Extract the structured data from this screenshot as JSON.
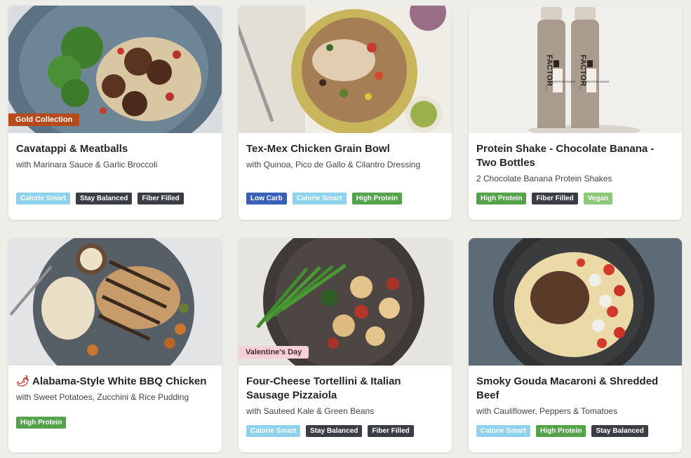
{
  "meals": [
    {
      "title": "Cavatappi & Meatballs",
      "subtitle": "with Marinara Sauce & Garlic Broccoli",
      "ribbon": "Gold Collection",
      "tags": [
        "Calorie Smart",
        "Stay Balanced",
        "Fiber Filled"
      ]
    },
    {
      "title": "Tex-Mex Chicken Grain Bowl",
      "subtitle": "with Quinoa, Pico de Gallo & Cilantro Dressing",
      "tags": [
        "Low Carb",
        "Calorie Smart",
        "High Protein"
      ]
    },
    {
      "title": "Protein Shake - Chocolate Banana - Two Bottles",
      "subtitle": "2 Chocolate Banana Protein Shakes",
      "bottle_brand": "FACTOR_",
      "bottle_label": "PROTEIN SHAKE",
      "tags": [
        "High Protein",
        "Fiber Filled",
        "Vegan"
      ]
    },
    {
      "title": "Alabama-Style White BBQ Chicken",
      "subtitle": "with Sweet Potatoes, Zucchini & Rice Pudding",
      "tags": [
        "High Protein"
      ]
    },
    {
      "title": "Four-Cheese Tortellini & Italian Sausage Pizzaiola",
      "subtitle": "with Sauteed Kale & Green Beans",
      "ribbon": "Valentine's Day",
      "tags": [
        "Calorie Smart",
        "Stay Balanced",
        "Fiber Filled"
      ]
    },
    {
      "title": "Smoky Gouda Macaroni & Shredded Beef",
      "subtitle": "with Cauliflower, Peppers & Tomatoes",
      "tags": [
        "Calorie Smart",
        "High Protein",
        "Stay Balanced"
      ]
    }
  ],
  "icons": {
    "spicy": "chili-pepper-icon"
  },
  "colors": {
    "calorie_smart": "#8fd2ee",
    "stay_balanced": "#3a3d44",
    "fiber_filled": "#3a3d44",
    "low_carb": "#3a60b8",
    "high_protein": "#54a24b",
    "vegan": "#8ec77a",
    "gold_collection": "#b64a1c",
    "valentines_day": "#f5d0d6"
  }
}
